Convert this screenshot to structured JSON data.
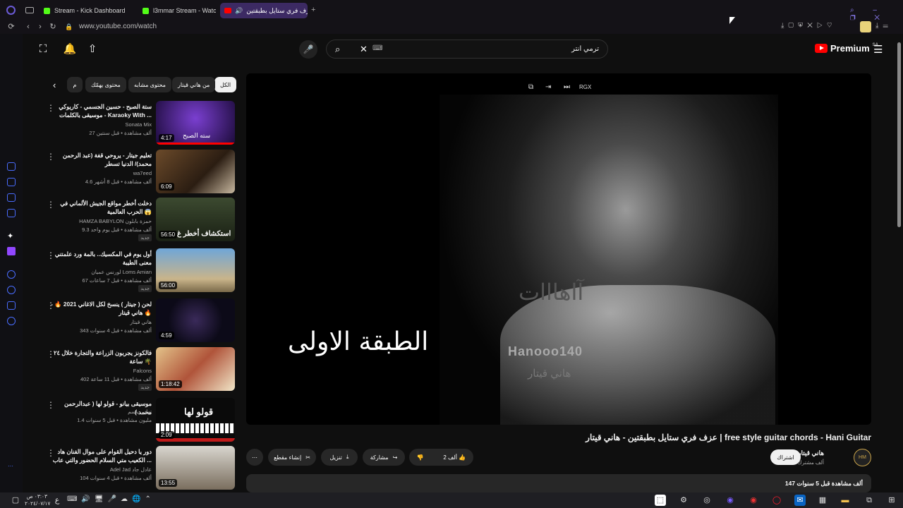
{
  "tabs": [
    {
      "label": "Stream - Kick Dashboard"
    },
    {
      "label": "l3mmar Stream - Watch L"
    },
    {
      "label": "عزف فري ستايل بطبقتين"
    }
  ],
  "url": "www.youtube.com/watch",
  "search": {
    "value": "ترمي انتر",
    "shortcut": "⌨"
  },
  "brand": {
    "label": "Premium",
    "region": "SA"
  },
  "chips": [
    "الكل",
    "من هاني قيتار",
    "محتوى مشابه",
    "محتوى يهمّك",
    "م"
  ],
  "player": {
    "overlay_text": "الطبقة الاولى",
    "watermark": "Hanooo140",
    "watermark_ar": "هاني قيتار",
    "watermark_ghost": "آاهااات",
    "controls": {
      "mode": "RGX"
    }
  },
  "recommendations": [
    {
      "title": "ستة الصبح - حسين الجسمي - كاريوكي موسيقى بالكلمات - Karaoky With ...",
      "channel": "Sonata Mix",
      "meta": "27 ألف مشاهدة • قبل سنتين",
      "duration": "4:17",
      "thumb_text": "سته الصبح",
      "new": ""
    },
    {
      "title": "تعليم جيتار - يروحي قفة (عبد الرحمن محمد)/ الدنيا تسطر",
      "channel": "wa7eed",
      "meta": "4.6 ألف مشاهدة • قبل 8 أشهر",
      "duration": "6:09",
      "thumb_text": "",
      "new": ""
    },
    {
      "title": "دخلت أخطر مواقع الجيش الألماني في الحرب العالمية 😱",
      "channel": "HAMZA BABYLON حمزة بابلون",
      "meta": "9.3 ألف مشاهدة • قبل يوم واحد",
      "duration": "56:50",
      "thumb_text": "استكشاف أخطر غ",
      "new": "جديد"
    },
    {
      "title": "أول يوم في المكسيك.. بالمة ورد علمتني معنى الطيبة",
      "channel": "لورنس عميان Loms Amian",
      "meta": "67 ألف مشاهدة • قبل 7 ساعات",
      "duration": "56:00",
      "thumb_text": "",
      "new": "جديد"
    },
    {
      "title": "لحن ( جيتار ) ينسخ لكل الاغاني 2021 🔥 - هاني قيتار 🔥",
      "channel": "هاني قيتار",
      "meta": "343 ألف مشاهدة • قبل 4 سنوات",
      "duration": "4:59",
      "thumb_text": "",
      "new": ""
    },
    {
      "title": "فالكونز يجربون الزراعة والتجارة خلال ٢٤ ساعة 🌴",
      "channel": "Falcons",
      "meta": "402 ألف مشاهدة • قبل 11 ساعة",
      "duration": "1:18:42",
      "thumb_text": "",
      "new": "جديد"
    },
    {
      "title": "موسيقى بيانو - قولو لها ( عبدالرحمن محمد )",
      "channel": "تهاني باسم",
      "meta": "1.4 مليون مشاهدة • قبل 5 سنوات",
      "duration": "2:09",
      "thumb_text": "قولو لها",
      "new": ""
    },
    {
      "title": "دور يا دحيل القوام على موال الفنان هاد الكعيب متي السلام الحضور والتي عاب ...",
      "channel": "Adel Jad عادل جاد",
      "meta": "104 ألف مشاهدة • قبل 4 سنوات",
      "duration": "13:55",
      "thumb_text": "",
      "new": ""
    }
  ],
  "video": {
    "title": "عزف فري ستايل بطبقتين - هاني قيتار | free style guitar chords - Hani Guitar",
    "channel": "هاني قيتار",
    "subscribers": "18.4 ألف مشترك",
    "subscribe_label": "اشتراك",
    "avatar_text": "HM",
    "likes": "2 ألف",
    "share": "مشاركة",
    "download": "تنزيل",
    "clip": "إنشاء مقطع",
    "views": "147 ألف مشاهدة قبل 5 سنوات"
  },
  "taskbar": {
    "time": "٠٣:٠٣ ص",
    "date": "٢٠٢٤/٠٧/١٧",
    "lang": "ع"
  }
}
